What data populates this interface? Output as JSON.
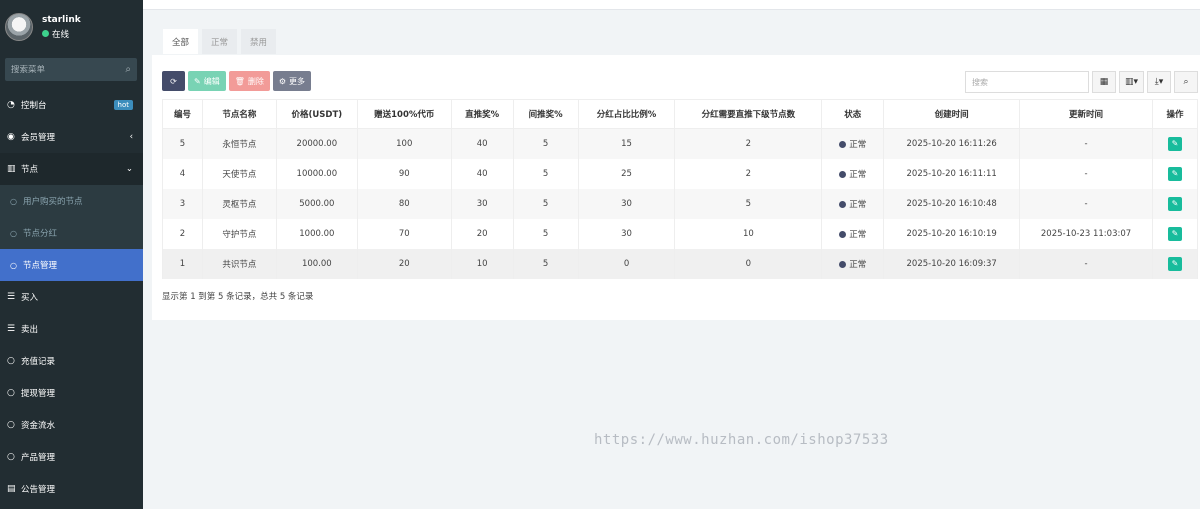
{
  "sidebar": {
    "user": {
      "name": "starlink",
      "status": "在线"
    },
    "search_placeholder": "搜索菜单",
    "menu": [
      {
        "label": "控制台",
        "icon": "dashboard-icon",
        "badge": "hot"
      },
      {
        "label": "会员管理",
        "icon": "user-circle-icon"
      },
      {
        "label": "节点",
        "icon": "trash-icon"
      },
      {
        "label": "买入",
        "icon": "list-icon"
      },
      {
        "label": "卖出",
        "icon": "list-icon"
      },
      {
        "label": "充值记录",
        "icon": "circle-icon"
      },
      {
        "label": "提现管理",
        "icon": "circle-icon"
      },
      {
        "label": "资金流水",
        "icon": "circle-icon"
      },
      {
        "label": "产品管理",
        "icon": "circle-icon"
      },
      {
        "label": "公告管理",
        "icon": "file-icon"
      }
    ],
    "submenu": [
      {
        "label": "用户购买的节点"
      },
      {
        "label": "节点分红"
      },
      {
        "label": "节点管理"
      }
    ]
  },
  "tabs": [
    "全部",
    "正常",
    "禁用"
  ],
  "toolbar": {
    "edit": "编辑",
    "delete": "删除",
    "more": "更多"
  },
  "table_search_placeholder": "搜索",
  "table": {
    "headers": [
      "编号",
      "节点名称",
      "价格(USDT)",
      "赠送100%代币",
      "直推奖%",
      "间推奖%",
      "分红占比比例%",
      "分红需要直推下级节点数",
      "状态",
      "创建时间",
      "更新时间",
      "操作"
    ],
    "rows": [
      [
        "5",
        "永恒节点",
        "20000.00",
        "100",
        "40",
        "5",
        "15",
        "2",
        "正常",
        "2025-10-20 16:11:26",
        "-"
      ],
      [
        "4",
        "天使节点",
        "10000.00",
        "90",
        "40",
        "5",
        "25",
        "2",
        "正常",
        "2025-10-20 16:11:11",
        "-"
      ],
      [
        "3",
        "灵枢节点",
        "5000.00",
        "80",
        "30",
        "5",
        "30",
        "5",
        "正常",
        "2025-10-20 16:10:48",
        "-"
      ],
      [
        "2",
        "守护节点",
        "1000.00",
        "70",
        "20",
        "5",
        "30",
        "10",
        "正常",
        "2025-10-20 16:10:19",
        "2025-10-23 11:03:07"
      ],
      [
        "1",
        "共识节点",
        "100.00",
        "20",
        "10",
        "5",
        "0",
        "0",
        "正常",
        "2025-10-20 16:09:37",
        "-"
      ]
    ]
  },
  "pagination_info": "显示第 1 到第 5 条记录，总共 5 条记录",
  "watermark": "https://www.huzhan.com/ishop37533",
  "colors": {
    "sidebar_bg": "#222d32",
    "active_menu": "#4270cb",
    "edit_green": "#18bc9c"
  }
}
